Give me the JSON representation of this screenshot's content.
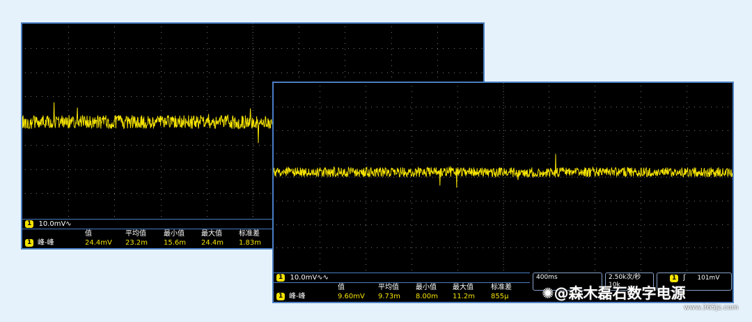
{
  "watermark": "@森木磊石数字电源",
  "site": "www.365jz.com",
  "colors": {
    "trace": "#f5e300",
    "background": "#e6f2fb",
    "frame": "#4a7fc4"
  },
  "scope_back": {
    "channel": {
      "badge": "1",
      "scale": "10.0mV∿"
    },
    "measurement": {
      "badge": "1",
      "label": "峰-峰",
      "headers": [
        "值",
        "平均值",
        "最小值",
        "最大值",
        "标准差"
      ],
      "values": [
        "24.4mV",
        "23.2m",
        "15.6m",
        "24.4m",
        "1.83m"
      ]
    },
    "noise_peak_to_peak_mV": 24.4
  },
  "scope_front": {
    "channel": {
      "badge": "1",
      "scale": "10.0mV∿∿"
    },
    "measurement": {
      "badge": "1",
      "label": "峰-峰",
      "headers": [
        "值",
        "平均值",
        "最小值",
        "最大值",
        "标准差"
      ],
      "values": [
        "9.60mV",
        "9.73m",
        "8.00m",
        "11.2m",
        "855μ"
      ]
    },
    "timebase": "400ms",
    "sample_rate": "2.50k次/秒",
    "record_length": "10k",
    "trigger": {
      "badge": "1",
      "icon": "rising-edge-icon",
      "level": "101mV"
    },
    "noise_peak_to_peak_mV": 9.6
  }
}
